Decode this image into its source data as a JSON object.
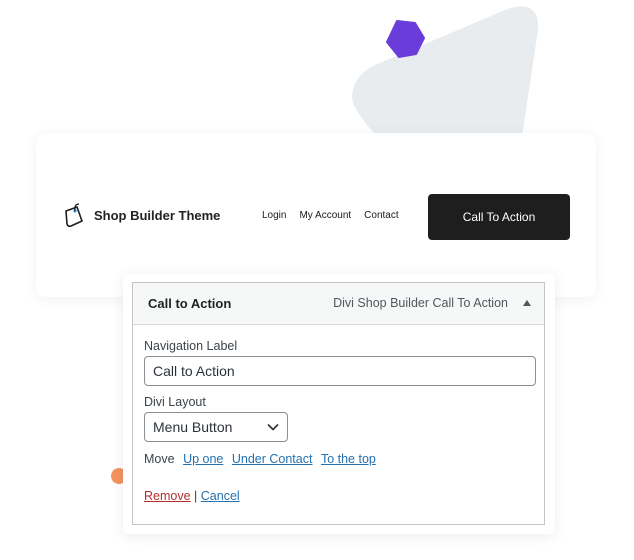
{
  "header_preview": {
    "brand_name": "Shop Builder Theme",
    "nav": [
      "Login",
      "My Account",
      "Contact"
    ],
    "cta_label": "Call To Action"
  },
  "menu_item": {
    "title": "Call to Action",
    "item_type": "Divi Shop Builder Call To Action",
    "navigation_label": {
      "label": "Navigation Label",
      "value": "Call to Action"
    },
    "divi_layout": {
      "label": "Divi Layout",
      "selected": "Menu Button"
    },
    "move": {
      "label": "Move",
      "links": [
        "Up one",
        "Under Contact",
        "To the top"
      ]
    },
    "actions": {
      "remove": "Remove",
      "separator": "|",
      "cancel": "Cancel"
    }
  },
  "colors": {
    "cta_background": "#1e1e1e",
    "link": "#2271b1",
    "remove": "#b32d2e",
    "hexagon": "#6a3ddb",
    "triangle": "#e8ecee",
    "dot": "#f4935f"
  }
}
